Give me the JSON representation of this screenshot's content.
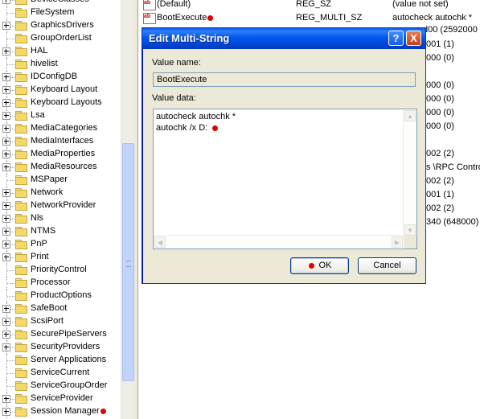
{
  "tree": {
    "items": [
      {
        "label": "DeviceClasses",
        "expand": true,
        "marked": false
      },
      {
        "label": "FileSystem",
        "expand": false,
        "marked": false
      },
      {
        "label": "GraphicsDrivers",
        "expand": true,
        "marked": false
      },
      {
        "label": "GroupOrderList",
        "expand": false,
        "marked": false
      },
      {
        "label": "HAL",
        "expand": true,
        "marked": false
      },
      {
        "label": "hivelist",
        "expand": false,
        "marked": false
      },
      {
        "label": "IDConfigDB",
        "expand": true,
        "marked": false
      },
      {
        "label": "Keyboard Layout",
        "expand": true,
        "marked": false
      },
      {
        "label": "Keyboard Layouts",
        "expand": true,
        "marked": false
      },
      {
        "label": "Lsa",
        "expand": true,
        "marked": false
      },
      {
        "label": "MediaCategories",
        "expand": true,
        "marked": false
      },
      {
        "label": "MediaInterfaces",
        "expand": true,
        "marked": false
      },
      {
        "label": "MediaProperties",
        "expand": true,
        "marked": false
      },
      {
        "label": "MediaResources",
        "expand": true,
        "marked": false
      },
      {
        "label": "MSPaper",
        "expand": false,
        "marked": false
      },
      {
        "label": "Network",
        "expand": true,
        "marked": false
      },
      {
        "label": "NetworkProvider",
        "expand": true,
        "marked": false
      },
      {
        "label": "Nls",
        "expand": true,
        "marked": false
      },
      {
        "label": "NTMS",
        "expand": true,
        "marked": false
      },
      {
        "label": "PnP",
        "expand": true,
        "marked": false
      },
      {
        "label": "Print",
        "expand": true,
        "marked": false
      },
      {
        "label": "PriorityControl",
        "expand": false,
        "marked": false
      },
      {
        "label": "Processor",
        "expand": false,
        "marked": false
      },
      {
        "label": "ProductOptions",
        "expand": false,
        "marked": false
      },
      {
        "label": "SafeBoot",
        "expand": true,
        "marked": false
      },
      {
        "label": "ScsiPort",
        "expand": true,
        "marked": false
      },
      {
        "label": "SecurePipeServers",
        "expand": true,
        "marked": false
      },
      {
        "label": "SecurityProviders",
        "expand": true,
        "marked": false
      },
      {
        "label": "Server Applications",
        "expand": false,
        "marked": false
      },
      {
        "label": "ServiceCurrent",
        "expand": false,
        "marked": false
      },
      {
        "label": "ServiceGroupOrder",
        "expand": false,
        "marked": false
      },
      {
        "label": "ServiceProvider",
        "expand": true,
        "marked": false
      },
      {
        "label": "Session Manager",
        "expand": true,
        "marked": true
      }
    ]
  },
  "values": {
    "rows": [
      {
        "name": "(Default)",
        "type": "REG_SZ",
        "data": "(value not set)",
        "marked": false
      },
      {
        "name": "BootExecute",
        "type": "REG_MULTI_SZ",
        "data": "autocheck autochk *",
        "marked": true
      }
    ],
    "partial_data": [
      "d00 (2592000",
      "001 (1)",
      "000 (0)",
      "000 (0)",
      "000 (0)",
      "000 (0)",
      "000 (0)",
      "002 (2)",
      "s \\RPC Contro",
      "002 (2)",
      "001 (1)",
      "002 (2)",
      "340 (648000)"
    ]
  },
  "dialog": {
    "title": "Edit Multi-String",
    "help_label": "?",
    "close_label": "X",
    "value_name_label": "Value name:",
    "value_name": "BootExecute",
    "value_data_label": "Value data:",
    "value_data_lines": [
      "autocheck autochk *",
      "autochk /x D:"
    ],
    "value_data_marked_line": 1,
    "ok_label": "OK",
    "cancel_label": "Cancel"
  },
  "colors": {
    "marker": "#e00000",
    "titlebar": "#0058ee",
    "dialog_bg": "#ece9d8"
  }
}
